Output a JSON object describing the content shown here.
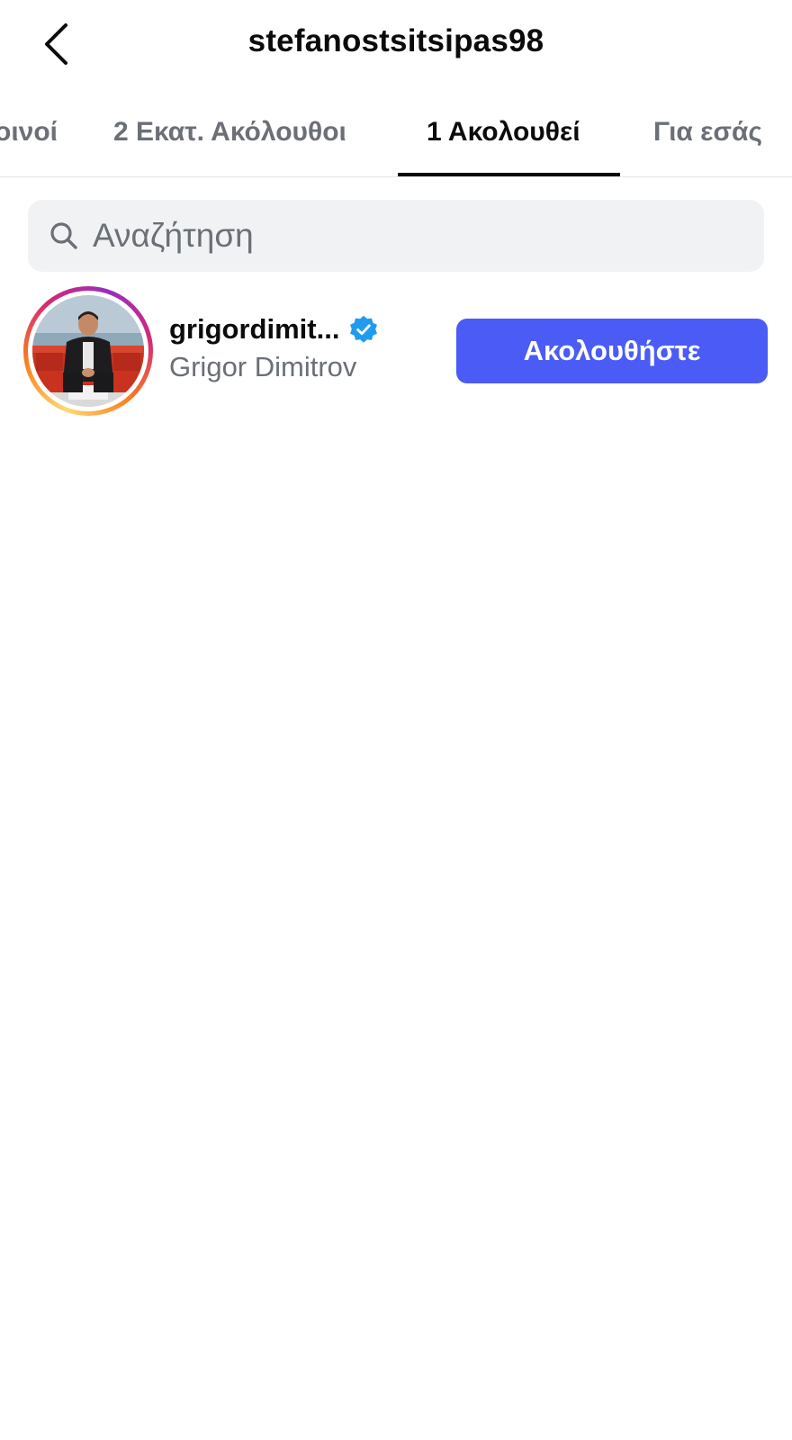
{
  "header": {
    "title": "stefanostsitsipas98",
    "back_icon": "chevron-left-icon"
  },
  "tabs": [
    {
      "label": "Κοινοί",
      "visible_label": "οινοί",
      "active": false
    },
    {
      "label": "2 Εκατ. Ακόλουθοι",
      "active": false
    },
    {
      "label": "1 Ακολουθεί",
      "active": true
    },
    {
      "label": "Για εσάς",
      "active": false
    }
  ],
  "search": {
    "placeholder": "Αναζήτηση",
    "value": "",
    "icon": "search-icon"
  },
  "following": [
    {
      "username": "grigordimit...",
      "full_name": "Grigor Dimitrov",
      "verified": true,
      "has_story_ring": true,
      "follow_button_label": "Ακολουθήστε"
    }
  ],
  "colors": {
    "follow_button": "#4a5cf5",
    "verified_badge": "#1f9bf0",
    "secondary_text": "#6b6f76",
    "search_bg": "#f1f2f4"
  }
}
